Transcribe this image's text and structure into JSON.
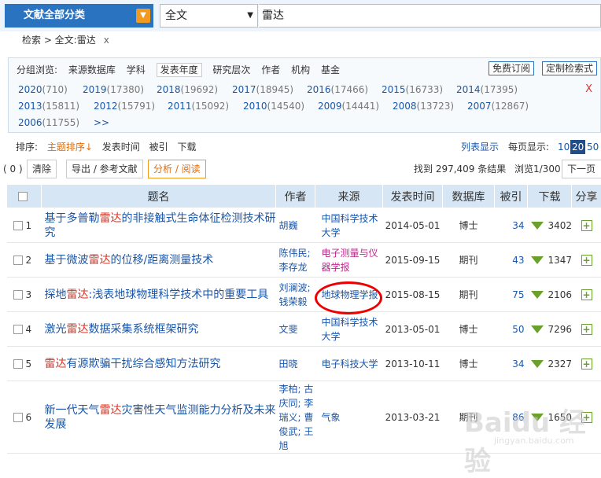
{
  "header": {
    "category": "文献全部分类",
    "scope": "全文",
    "query": "雷达"
  },
  "breadcrumb": {
    "text": "检索 > 全文:雷达",
    "close": "x"
  },
  "filter": {
    "label": "分组浏览:",
    "tabs": [
      "来源数据库",
      "学科",
      "发表年度",
      "研究层次",
      "作者",
      "机构",
      "基金"
    ],
    "subscribe": "免费订阅",
    "custom": "定制检索式",
    "close": "X",
    "years": [
      {
        "y": "2020",
        "c": "(710)"
      },
      {
        "y": "2019",
        "c": "(17380)"
      },
      {
        "y": "2018",
        "c": "(19692)"
      },
      {
        "y": "2017",
        "c": "(18945)"
      },
      {
        "y": "2016",
        "c": "(17466)"
      },
      {
        "y": "2015",
        "c": "(16733)"
      },
      {
        "y": "2014",
        "c": "(17395)"
      },
      {
        "y": "2013",
        "c": "(15811)"
      },
      {
        "y": "2012",
        "c": "(15791)"
      },
      {
        "y": "2011",
        "c": "(15092)"
      },
      {
        "y": "2010",
        "c": "(14540)"
      },
      {
        "y": "2009",
        "c": "(14441)"
      },
      {
        "y": "2008",
        "c": "(13723)"
      },
      {
        "y": "2007",
        "c": "(12867)"
      },
      {
        "y": "2006",
        "c": "(11755)"
      },
      {
        "y": ">>",
        "c": ""
      }
    ]
  },
  "sort": {
    "label": "排序:",
    "options": [
      "主题排序↓",
      "发表时间",
      "被引",
      "下载"
    ],
    "list": "列表显示",
    "per": "每页显示:",
    "sizes": [
      "10",
      "20",
      "50"
    ]
  },
  "actions": {
    "count": "( 0 )",
    "clear": "清除",
    "export": "导出 / 参考文献",
    "analyze": "分析 / 阅读",
    "found": "找到 297,409 条结果",
    "page": "浏览1/300",
    "next": "下一页"
  },
  "table": {
    "headers": [
      "题名",
      "作者",
      "来源",
      "发表时间",
      "数据库",
      "被引",
      "下载",
      "分享"
    ],
    "rows": [
      {
        "n": "1",
        "t1": "基于多普勒",
        "hl": "雷达",
        "t2": "的非接触式生命体征检测技术研究",
        "au": "胡巍",
        "so": "中国科学技术大学",
        "date": "2014-05-01",
        "db": "博士",
        "cite": "34",
        "dl": "3402"
      },
      {
        "n": "2",
        "t1": "基于微波",
        "hl": "雷达",
        "t2": "的位移/距离测量技术",
        "au": "陈伟民; 李存龙",
        "so": "电子测量与仪器学报",
        "date": "2015-09-15",
        "db": "期刊",
        "cite": "43",
        "dl": "1347"
      },
      {
        "n": "3",
        "t1": "探地",
        "hl": "雷达",
        "t2": ":浅表地球物理科学技术中的重要工具",
        "au": "刘澜波; 钱荣毅",
        "so": "地球物理学报",
        "date": "2015-08-15",
        "db": "期刊",
        "cite": "75",
        "dl": "2106"
      },
      {
        "n": "4",
        "t1": "激光",
        "hl": "雷达",
        "t2": "数据采集系统框架研究",
        "au": "文斐",
        "so": "中国科学技术大学",
        "date": "2013-05-01",
        "db": "博士",
        "cite": "50",
        "dl": "7296"
      },
      {
        "n": "5",
        "t1": "",
        "hl": "雷达",
        "t2": "有源欺骗干扰综合感知方法研究",
        "au": "田晓",
        "so": "电子科技大学",
        "date": "2013-10-11",
        "db": "博士",
        "cite": "34",
        "dl": "2327"
      },
      {
        "n": "6",
        "t1": "新一代天气",
        "hl": "雷达",
        "t2": "灾害性天气监测能力分析及未来发展",
        "au": "李柏; 古庆同; 李瑞义; 曹俊武; 王旭",
        "so": "气象",
        "date": "2013-03-21",
        "db": "期刊",
        "cite": "86",
        "dl": "1650"
      }
    ]
  },
  "watermark": {
    "logo": "Baidu 经验",
    "sub": "jingyan.baidu.com"
  }
}
